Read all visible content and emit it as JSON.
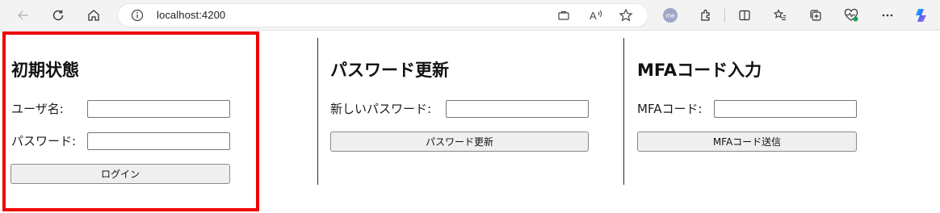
{
  "browser": {
    "url": "localhost:4200",
    "profile_initials": "me",
    "icons": {
      "back": "back-arrow-icon",
      "refresh": "refresh-icon",
      "home": "home-icon",
      "site_info": "info-icon",
      "app_available": "app-available-icon",
      "read_aloud": "read-aloud-icon",
      "favorite": "star-icon",
      "extensions": "extensions-icon",
      "split_screen": "split-screen-icon",
      "favorites_bar": "favorites-list-icon",
      "collections": "collections-icon",
      "browser_essentials": "heart-pulse-icon",
      "more": "more-icon",
      "copilot": "copilot-icon"
    }
  },
  "sections": {
    "initial": {
      "title": "初期状態",
      "username_label": "ユーザ名:",
      "username_value": "",
      "password_label": "パスワード:",
      "password_value": "",
      "login_button": "ログイン",
      "highlighted": true,
      "highlight_color": "#ee0000"
    },
    "password_update": {
      "title": "パスワード更新",
      "new_password_label": "新しいパスワード:",
      "new_password_value": "",
      "update_button": "パスワード更新"
    },
    "mfa": {
      "title": "MFAコード入力",
      "mfa_label": "MFAコード:",
      "mfa_value": "",
      "send_button": "MFAコード送信"
    }
  }
}
